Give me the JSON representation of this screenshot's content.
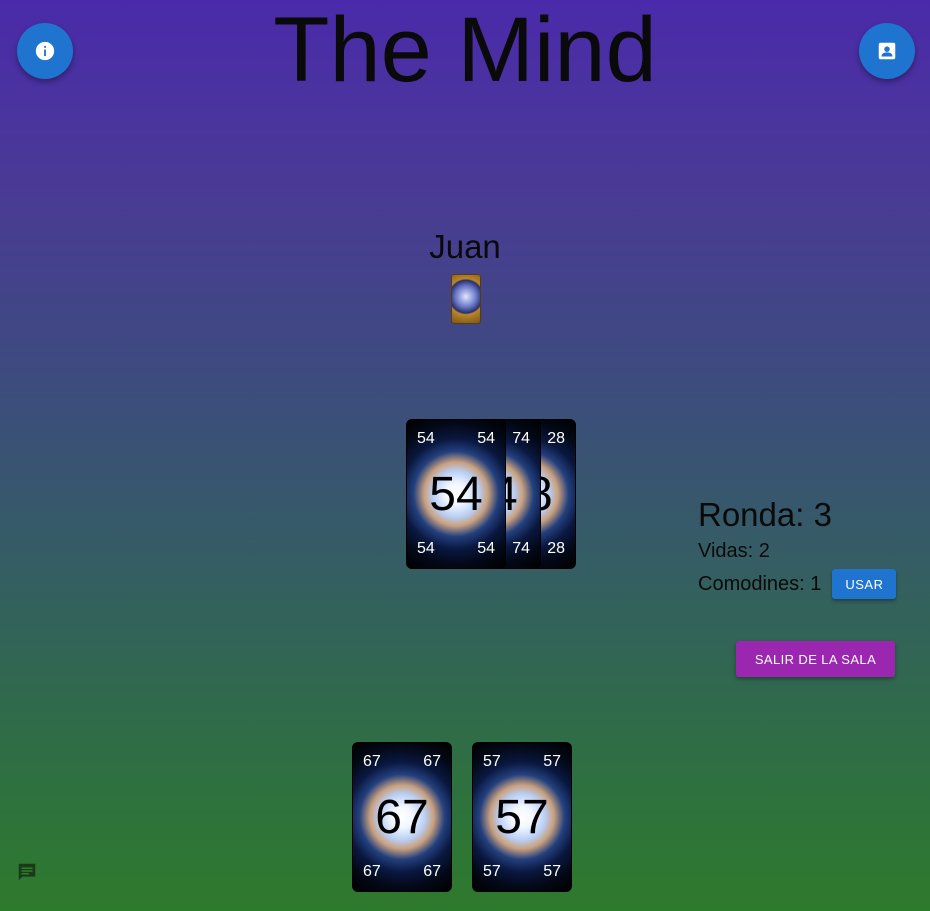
{
  "game": {
    "title": "The Mind",
    "player_name": "Juan"
  },
  "table_cards": [
    {
      "value": "28"
    },
    {
      "value": "74"
    },
    {
      "value": "54"
    }
  ],
  "hand_cards": [
    {
      "value": "67"
    },
    {
      "value": "57"
    }
  ],
  "status": {
    "ronda": "Ronda: 3",
    "vidas": "Vidas: 2",
    "comodines": "Comodines: 1"
  },
  "buttons": {
    "usar": "USAR",
    "salir": "SALIR DE LA SALA"
  },
  "icons": {
    "info": "info-icon",
    "profile": "account-box-icon",
    "chat": "chat-icon"
  },
  "colors": {
    "primary": "#1f74d0",
    "secondary": "#9b27b0"
  }
}
